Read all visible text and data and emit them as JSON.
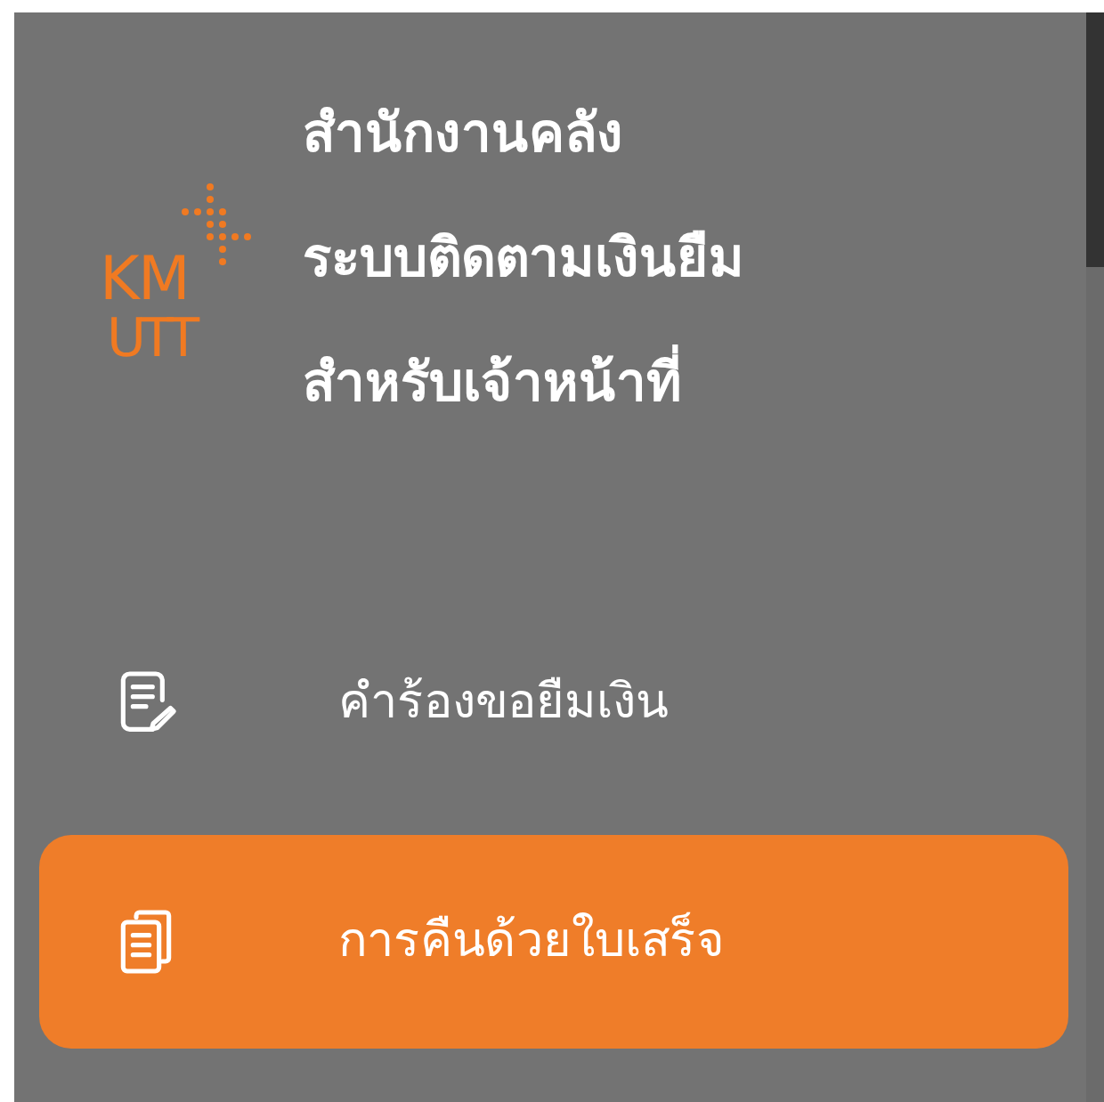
{
  "logo": {
    "top": "KM",
    "bottom": "UTT"
  },
  "title_lines": [
    "สำนักงานคลัง",
    "ระบบติดตามเงินยืม",
    "สำหรับเจ้าหน้าที่"
  ],
  "menu": [
    {
      "label": "คำร้องขอยืมเงิน",
      "kind": "request",
      "selected": false
    },
    {
      "label": "การคืนด้วยใบเสร็จ",
      "kind": "receipt",
      "selected": true
    }
  ]
}
